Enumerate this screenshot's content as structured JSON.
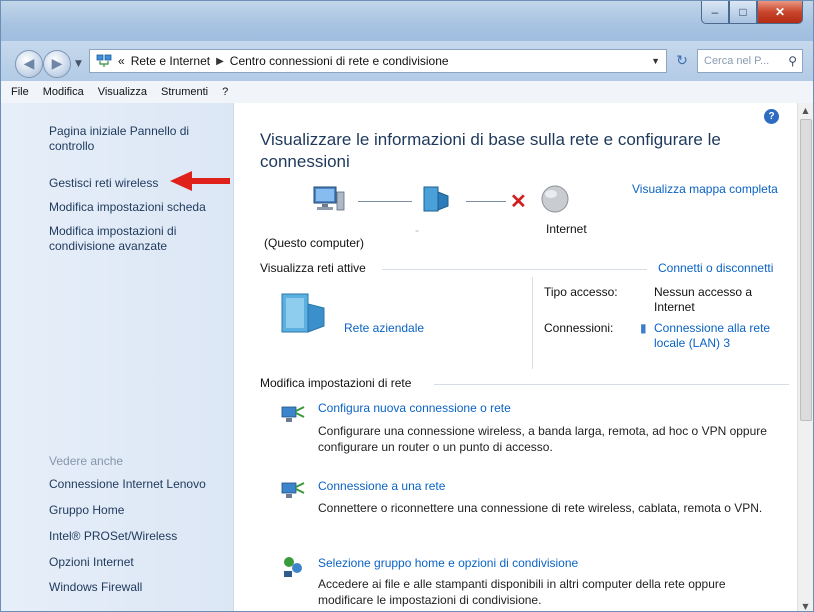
{
  "window": {
    "controls": {
      "minimize": "–",
      "maximize": "□",
      "close": "✕"
    }
  },
  "navigation": {
    "breadcrumb": [
      "«",
      "Rete e Internet",
      "Centro connessioni di rete e condivisione"
    ],
    "search_placeholder": "Cerca nel P...",
    "icons": {
      "back": "arrow-left-icon",
      "forward": "arrow-right-icon",
      "refresh": "refresh-icon",
      "search": "search-icon"
    }
  },
  "menu": [
    "File",
    "Modifica",
    "Visualizza",
    "Strumenti",
    "?"
  ],
  "sidebar": {
    "top_links": [
      "Pagina iniziale Pannello di controllo",
      "Gestisci reti wireless",
      "Modifica impostazioni scheda",
      "Modifica impostazioni di condivisione avanzate"
    ],
    "see_also_title": "Vedere anche",
    "see_also_links": [
      "Connessione Internet Lenovo",
      "Gruppo Home",
      "Intel® PROSet/Wireless",
      "Opzioni Internet",
      "Windows Firewall"
    ]
  },
  "main": {
    "heading": "Visualizzare le informazioni di base sulla rete e configurare le connessioni",
    "map": {
      "full_map_link": "Visualizza mappa completa",
      "computer_label": "(Questo computer)",
      "middle_label": "-",
      "internet_label": "Internet"
    },
    "active_networks": {
      "title": "Visualizza reti attive",
      "action_link": "Connetti o disconnetti",
      "network_name": "Rete aziendale",
      "access_type_label": "Tipo accesso:",
      "access_type_value": "Nessun accesso a Internet",
      "connections_label": "Connessioni:",
      "connections_value": "Connessione alla rete locale (LAN) 3"
    },
    "settings": {
      "title": "Modifica impostazioni di rete",
      "items": [
        {
          "link": "Configura nuova connessione o rete",
          "description": "Configurare una connessione wireless, a banda larga, remota, ad hoc o VPN oppure configurare un router o un punto di accesso."
        },
        {
          "link": "Connessione a una rete",
          "description": "Connettere o riconnettere una connessione di rete wireless, cablata, remota o VPN."
        },
        {
          "link": "Selezione gruppo home e opzioni di condivisione",
          "description": "Accedere ai file e alle stampanti disponibili in altri computer della rete oppure modificare le impostazioni di condivisione."
        }
      ]
    },
    "help": "?"
  },
  "colors": {
    "link": "#0b63c4",
    "heading": "#1e395b",
    "annotation_arrow": "#e0201a",
    "error_x": "#d11f1f"
  }
}
